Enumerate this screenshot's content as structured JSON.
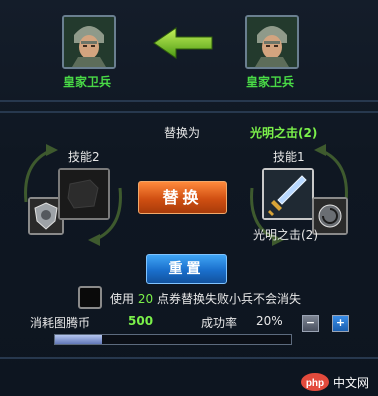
{
  "units": {
    "current_name": "皇家卫兵",
    "target_name": "皇家卫兵"
  },
  "replace": {
    "prefix_label": "替换为",
    "target_skill": "光明之击(2)"
  },
  "skills": {
    "left_slot_label": "技能2",
    "right_slot_label": "技能1",
    "right_skill_name": "光明之击(2)"
  },
  "buttons": {
    "replace_label": "替换",
    "reset_label": "重置"
  },
  "voucher": {
    "checked": false,
    "text_before": "使用",
    "points": "20",
    "text_after": "点券替换失败小兵不会消失"
  },
  "cost": {
    "label": "消耗图腾币",
    "value": "500"
  },
  "success": {
    "label": "成功率",
    "value": "20%",
    "minus": "−",
    "plus": "+",
    "fraction": 0.2
  },
  "colors": {
    "green": "#49d946",
    "orange": "#d04f12",
    "blue": "#1a6fcc"
  },
  "watermark": {
    "logo_text": "php",
    "site_text": "中文网"
  }
}
